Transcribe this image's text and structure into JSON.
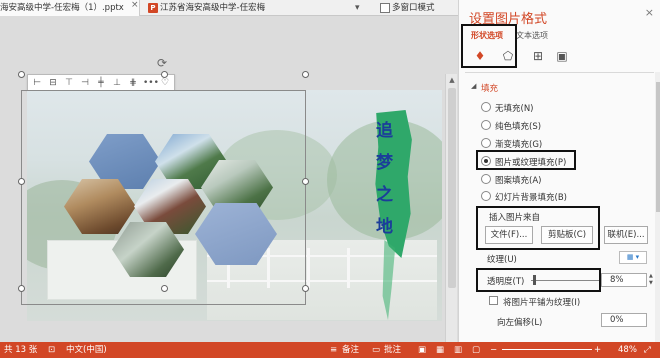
{
  "tabs": [
    {
      "label": "海安高级中学-任宏梅（1）.pptx",
      "close": "×"
    },
    {
      "label": "江苏省海安高级中学-任宏梅",
      "badge": "P"
    }
  ],
  "tab_dropdown": "▾",
  "mode_label": "多窗口模式",
  "pane": {
    "title": "设置图片格式",
    "close": "×",
    "subtab_shape": "形状选项",
    "subtab_text": "文本选项",
    "section_fill": "填充",
    "fill_options": [
      {
        "label": "无填充(N)",
        "checked": false
      },
      {
        "label": "纯色填充(S)",
        "checked": false
      },
      {
        "label": "渐变填充(G)",
        "checked": false
      },
      {
        "label": "图片或纹理填充(P)",
        "checked": true
      },
      {
        "label": "图案填充(A)",
        "checked": false
      },
      {
        "label": "幻灯片背景填充(B)",
        "checked": false
      }
    ],
    "insert_from": "插入图片来自",
    "btn_file": "文件(F)...",
    "btn_clipboard": "剪贴板(C)",
    "btn_online": "联机(E)...",
    "texture_label": "纹理(U)",
    "transparency_label": "透明度(T)",
    "transparency_value": "8%",
    "tile_label": "将图片平铺为纹理(I)",
    "offset_left_label": "向左偏移(L)",
    "offset_left_value": "0%"
  },
  "slide": {
    "calligraphy": [
      "追",
      "梦",
      "之",
      "地"
    ]
  },
  "status": {
    "slide_count": "共 13 张",
    "language": "中文(中国)",
    "notes": "备注",
    "comments": "批注",
    "zoom": "48%"
  },
  "colors": {
    "accent": "#d24726",
    "brush_green": "#2fa86a",
    "hex_blue": "#6b8cbf"
  }
}
